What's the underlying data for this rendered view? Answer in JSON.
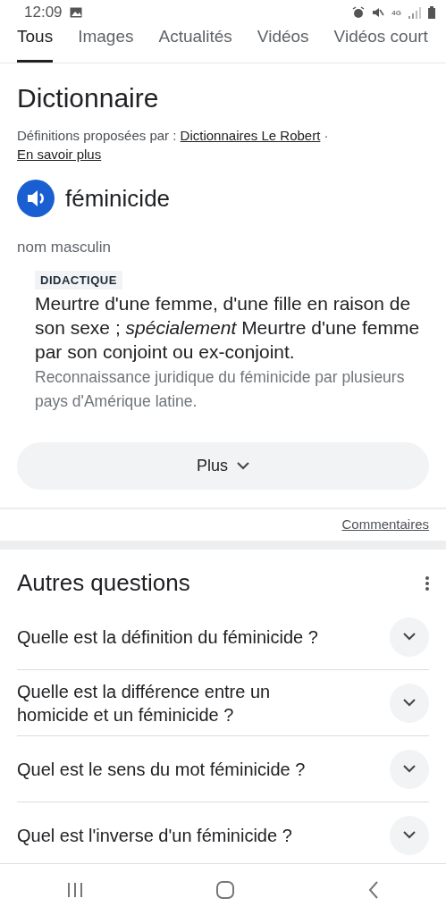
{
  "status_bar": {
    "time": "12:09",
    "network": "4G"
  },
  "tabs": [
    {
      "label": "Tous",
      "selected": true
    },
    {
      "label": "Images",
      "selected": false
    },
    {
      "label": "Actualités",
      "selected": false
    },
    {
      "label": "Vidéos",
      "selected": false
    },
    {
      "label": "Vidéos court",
      "selected": false
    }
  ],
  "dictionary": {
    "title": "Dictionnaire",
    "attribution": "Définitions proposées par :",
    "source_link": "Dictionnaires Le Robert",
    "separator": "·",
    "more_link": "En savoir plus",
    "word": "féminicide",
    "part_of_speech": "nom masculin",
    "senses": [
      {
        "label": "DIDACTIQUE",
        "definition": "Meurtre d'une femme, d'une fille en raison de son sexe ; *spécialement* Meurtre d'une femme par son conjoint ou ex-conjoint.",
        "example": "Reconnaissance juridique du féminicide par plusieurs pays d'Amérique latine."
      }
    ],
    "more_button": "Plus",
    "feedback_link": "Commentaires"
  },
  "questions": {
    "title": "Autres questions",
    "items": [
      {
        "question": "Quelle est la définition du féminicide ?"
      },
      {
        "question": "Quelle est la différence entre un homicide et un féminicide ?"
      },
      {
        "question": "Quel est le sens du mot féminicide ?"
      },
      {
        "question": "Quel est l'inverse d'un féminicide ?"
      }
    ]
  }
}
